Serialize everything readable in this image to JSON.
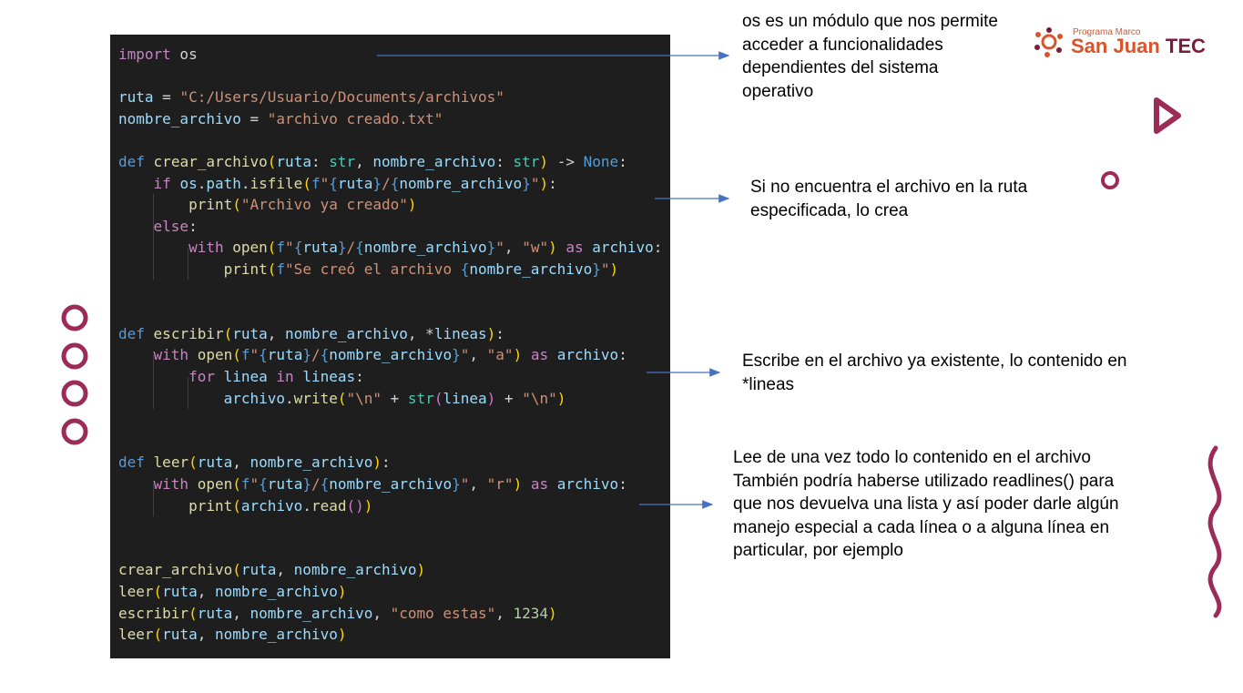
{
  "code": {
    "lines": [
      {
        "tokens": [
          [
            "kw",
            "import"
          ],
          [
            "tx",
            " os"
          ]
        ]
      },
      {
        "tokens": []
      },
      {
        "tokens": [
          [
            "vr",
            "ruta"
          ],
          [
            "tx",
            " = "
          ],
          [
            "st",
            "\"C:/Users/Usuario/Documents/archivos\""
          ]
        ]
      },
      {
        "tokens": [
          [
            "vr",
            "nombre_archivo"
          ],
          [
            "tx",
            " = "
          ],
          [
            "st",
            "\"archivo creado.txt\""
          ]
        ]
      },
      {
        "tokens": []
      },
      {
        "tokens": [
          [
            "kwb",
            "def"
          ],
          [
            "tx",
            " "
          ],
          [
            "fn",
            "crear_archivo"
          ],
          [
            "br1",
            "("
          ],
          [
            "vr",
            "ruta"
          ],
          [
            "tx",
            ": "
          ],
          [
            "ty",
            "str"
          ],
          [
            "tx",
            ", "
          ],
          [
            "vr",
            "nombre_archivo"
          ],
          [
            "tx",
            ": "
          ],
          [
            "ty",
            "str"
          ],
          [
            "br1",
            ")"
          ],
          [
            "tx",
            " -> "
          ],
          [
            "kwb",
            "None"
          ],
          [
            "tx",
            ":"
          ]
        ]
      },
      {
        "tokens": [
          [
            "tx",
            "    "
          ],
          [
            "kw",
            "if"
          ],
          [
            "tx",
            " "
          ],
          [
            "vr",
            "os"
          ],
          [
            "tx",
            "."
          ],
          [
            "vr",
            "path"
          ],
          [
            "tx",
            "."
          ],
          [
            "fn",
            "isfile"
          ],
          [
            "br1",
            "("
          ],
          [
            "kwb",
            "f"
          ],
          [
            "st",
            "\""
          ],
          [
            "kwb",
            "{"
          ],
          [
            "vr",
            "ruta"
          ],
          [
            "kwb",
            "}"
          ],
          [
            "st",
            "/"
          ],
          [
            "kwb",
            "{"
          ],
          [
            "vr",
            "nombre_archivo"
          ],
          [
            "kwb",
            "}"
          ],
          [
            "st",
            "\""
          ],
          [
            "br1",
            ")"
          ],
          [
            "tx",
            ":"
          ]
        ]
      },
      {
        "tokens": [
          [
            "tx",
            "        "
          ],
          [
            "fn",
            "print"
          ],
          [
            "br1",
            "("
          ],
          [
            "st",
            "\"Archivo ya creado\""
          ],
          [
            "br1",
            ")"
          ]
        ]
      },
      {
        "tokens": [
          [
            "tx",
            "    "
          ],
          [
            "kw",
            "else"
          ],
          [
            "tx",
            ":"
          ]
        ]
      },
      {
        "tokens": [
          [
            "tx",
            "        "
          ],
          [
            "kw",
            "with"
          ],
          [
            "tx",
            " "
          ],
          [
            "fn",
            "open"
          ],
          [
            "br1",
            "("
          ],
          [
            "kwb",
            "f"
          ],
          [
            "st",
            "\""
          ],
          [
            "kwb",
            "{"
          ],
          [
            "vr",
            "ruta"
          ],
          [
            "kwb",
            "}"
          ],
          [
            "st",
            "/"
          ],
          [
            "kwb",
            "{"
          ],
          [
            "vr",
            "nombre_archivo"
          ],
          [
            "kwb",
            "}"
          ],
          [
            "st",
            "\""
          ],
          [
            "tx",
            ", "
          ],
          [
            "st",
            "\"w\""
          ],
          [
            "br1",
            ")"
          ],
          [
            "tx",
            " "
          ],
          [
            "kw",
            "as"
          ],
          [
            "tx",
            " "
          ],
          [
            "vr",
            "archivo"
          ],
          [
            "tx",
            ":"
          ]
        ]
      },
      {
        "tokens": [
          [
            "tx",
            "            "
          ],
          [
            "fn",
            "print"
          ],
          [
            "br1",
            "("
          ],
          [
            "kwb",
            "f"
          ],
          [
            "st",
            "\"Se creó el archivo "
          ],
          [
            "kwb",
            "{"
          ],
          [
            "vr",
            "nombre_archivo"
          ],
          [
            "kwb",
            "}"
          ],
          [
            "st",
            "\""
          ],
          [
            "br1",
            ")"
          ]
        ]
      },
      {
        "tokens": []
      },
      {
        "tokens": []
      },
      {
        "tokens": [
          [
            "kwb",
            "def"
          ],
          [
            "tx",
            " "
          ],
          [
            "fn",
            "escribir"
          ],
          [
            "br1",
            "("
          ],
          [
            "vr",
            "ruta"
          ],
          [
            "tx",
            ", "
          ],
          [
            "vr",
            "nombre_archivo"
          ],
          [
            "tx",
            ", *"
          ],
          [
            "vr",
            "lineas"
          ],
          [
            "br1",
            ")"
          ],
          [
            "tx",
            ":"
          ]
        ]
      },
      {
        "tokens": [
          [
            "tx",
            "    "
          ],
          [
            "kw",
            "with"
          ],
          [
            "tx",
            " "
          ],
          [
            "fn",
            "open"
          ],
          [
            "br1",
            "("
          ],
          [
            "kwb",
            "f"
          ],
          [
            "st",
            "\""
          ],
          [
            "kwb",
            "{"
          ],
          [
            "vr",
            "ruta"
          ],
          [
            "kwb",
            "}"
          ],
          [
            "st",
            "/"
          ],
          [
            "kwb",
            "{"
          ],
          [
            "vr",
            "nombre_archivo"
          ],
          [
            "kwb",
            "}"
          ],
          [
            "st",
            "\""
          ],
          [
            "tx",
            ", "
          ],
          [
            "st",
            "\"a\""
          ],
          [
            "br1",
            ")"
          ],
          [
            "tx",
            " "
          ],
          [
            "kw",
            "as"
          ],
          [
            "tx",
            " "
          ],
          [
            "vr",
            "archivo"
          ],
          [
            "tx",
            ":"
          ]
        ]
      },
      {
        "tokens": [
          [
            "tx",
            "        "
          ],
          [
            "kw",
            "for"
          ],
          [
            "tx",
            " "
          ],
          [
            "vr",
            "linea"
          ],
          [
            "tx",
            " "
          ],
          [
            "kw",
            "in"
          ],
          [
            "tx",
            " "
          ],
          [
            "vr",
            "lineas"
          ],
          [
            "tx",
            ":"
          ]
        ]
      },
      {
        "tokens": [
          [
            "tx",
            "            "
          ],
          [
            "vr",
            "archivo"
          ],
          [
            "tx",
            "."
          ],
          [
            "fn",
            "write"
          ],
          [
            "br1",
            "("
          ],
          [
            "st",
            "\"\\n\""
          ],
          [
            "tx",
            " + "
          ],
          [
            "ty",
            "str"
          ],
          [
            "br2",
            "("
          ],
          [
            "vr",
            "linea"
          ],
          [
            "br2",
            ")"
          ],
          [
            "tx",
            " + "
          ],
          [
            "st",
            "\"\\n\""
          ],
          [
            "br1",
            ")"
          ]
        ]
      },
      {
        "tokens": []
      },
      {
        "tokens": []
      },
      {
        "tokens": [
          [
            "kwb",
            "def"
          ],
          [
            "tx",
            " "
          ],
          [
            "fn",
            "leer"
          ],
          [
            "br1",
            "("
          ],
          [
            "vr",
            "ruta"
          ],
          [
            "tx",
            ", "
          ],
          [
            "vr",
            "nombre_archivo"
          ],
          [
            "br1",
            ")"
          ],
          [
            "tx",
            ":"
          ]
        ]
      },
      {
        "tokens": [
          [
            "tx",
            "    "
          ],
          [
            "kw",
            "with"
          ],
          [
            "tx",
            " "
          ],
          [
            "fn",
            "open"
          ],
          [
            "br1",
            "("
          ],
          [
            "kwb",
            "f"
          ],
          [
            "st",
            "\""
          ],
          [
            "kwb",
            "{"
          ],
          [
            "vr",
            "ruta"
          ],
          [
            "kwb",
            "}"
          ],
          [
            "st",
            "/"
          ],
          [
            "kwb",
            "{"
          ],
          [
            "vr",
            "nombre_archivo"
          ],
          [
            "kwb",
            "}"
          ],
          [
            "st",
            "\""
          ],
          [
            "tx",
            ", "
          ],
          [
            "st",
            "\"r\""
          ],
          [
            "br1",
            ")"
          ],
          [
            "tx",
            " "
          ],
          [
            "kw",
            "as"
          ],
          [
            "tx",
            " "
          ],
          [
            "vr",
            "archivo"
          ],
          [
            "tx",
            ":"
          ]
        ]
      },
      {
        "tokens": [
          [
            "tx",
            "        "
          ],
          [
            "fn",
            "print"
          ],
          [
            "br1",
            "("
          ],
          [
            "vr",
            "archivo"
          ],
          [
            "tx",
            "."
          ],
          [
            "fn",
            "read"
          ],
          [
            "br2",
            "()"
          ],
          [
            "br1",
            ")"
          ]
        ]
      },
      {
        "tokens": []
      },
      {
        "tokens": []
      },
      {
        "tokens": [
          [
            "fn",
            "crear_archivo"
          ],
          [
            "br1",
            "("
          ],
          [
            "vr",
            "ruta"
          ],
          [
            "tx",
            ", "
          ],
          [
            "vr",
            "nombre_archivo"
          ],
          [
            "br1",
            ")"
          ]
        ]
      },
      {
        "tokens": [
          [
            "fn",
            "leer"
          ],
          [
            "br1",
            "("
          ],
          [
            "vr",
            "ruta"
          ],
          [
            "tx",
            ", "
          ],
          [
            "vr",
            "nombre_archivo"
          ],
          [
            "br1",
            ")"
          ]
        ]
      },
      {
        "tokens": [
          [
            "fn",
            "escribir"
          ],
          [
            "br1",
            "("
          ],
          [
            "vr",
            "ruta"
          ],
          [
            "tx",
            ", "
          ],
          [
            "vr",
            "nombre_archivo"
          ],
          [
            "tx",
            ", "
          ],
          [
            "st",
            "\"como estas\""
          ],
          [
            "tx",
            ", "
          ],
          [
            "nu",
            "1234"
          ],
          [
            "br1",
            ")"
          ]
        ]
      },
      {
        "tokens": [
          [
            "fn",
            "leer"
          ],
          [
            "br1",
            "("
          ],
          [
            "vr",
            "ruta"
          ],
          [
            "tx",
            ", "
          ],
          [
            "vr",
            "nombre_archivo"
          ],
          [
            "br1",
            ")"
          ]
        ]
      }
    ]
  },
  "annotations": {
    "os_note": [
      "os es un módulo que nos permite",
      "acceder a funcionalidades",
      "dependientes del sistema",
      "operativo"
    ],
    "crear_note": [
      "Si no encuentra el archivo en la ruta",
      "especificada, lo crea"
    ],
    "escribir_note": [
      "Escribe en el archivo ya existente, lo contenido en",
      "*lineas"
    ],
    "leer_note": [
      "Lee de una vez todo lo contenido en el archivo",
      "También podría haberse utilizado readlines() para",
      "que nos devuelva una lista y así poder darle algún",
      "manejo especial a cada línea o a alguna línea en",
      "particular, por ejemplo"
    ]
  },
  "logo": {
    "subtitle": "Programa Marco",
    "name_part1": "San Juan ",
    "name_part2": "TEC"
  },
  "colors": {
    "accent_burgundy": "#9b2c58",
    "arrow_blue": "#4472c4",
    "logo_orange": "#d9542b",
    "code_background": "#1e1e1e"
  }
}
